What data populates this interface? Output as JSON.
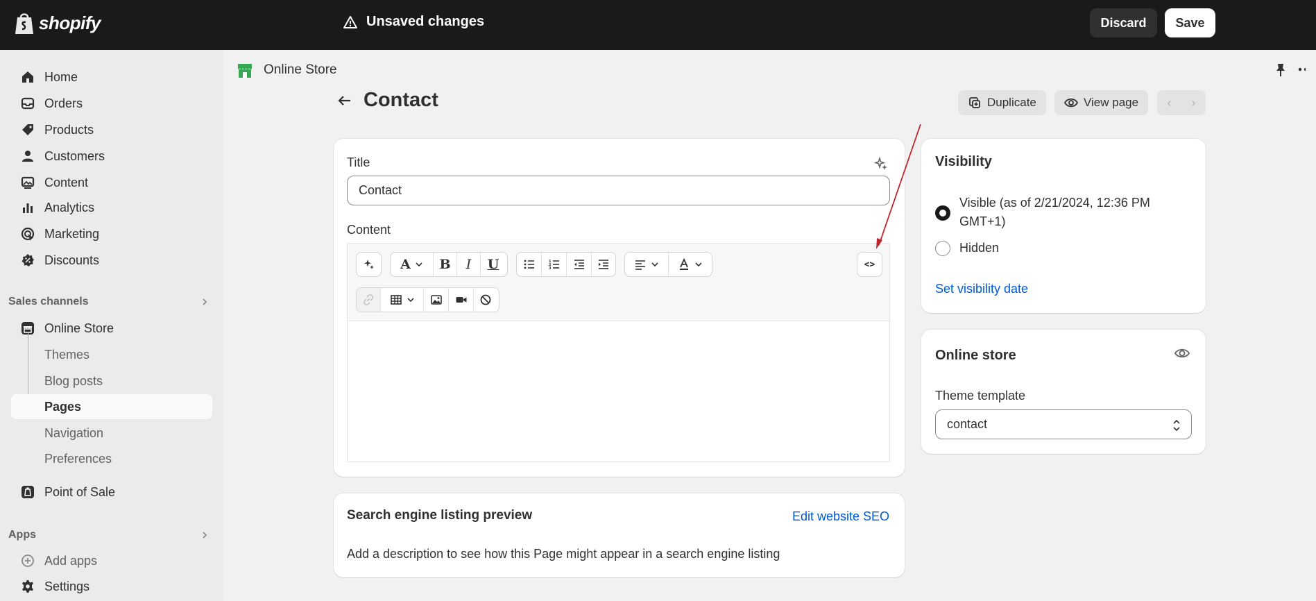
{
  "topbar": {
    "logo_text": "shopify",
    "status": "Unsaved changes",
    "discard_label": "Discard",
    "save_label": "Save"
  },
  "sidebar": {
    "items": [
      {
        "label": "Home",
        "icon": "home-icon"
      },
      {
        "label": "Orders",
        "icon": "inbox-icon"
      },
      {
        "label": "Products",
        "icon": "tag-icon"
      },
      {
        "label": "Customers",
        "icon": "person-icon"
      },
      {
        "label": "Content",
        "icon": "image-content-icon"
      },
      {
        "label": "Analytics",
        "icon": "bar-chart-icon"
      },
      {
        "label": "Marketing",
        "icon": "target-icon"
      },
      {
        "label": "Discounts",
        "icon": "discount-icon"
      }
    ],
    "sales_channels_label": "Sales channels",
    "online_store_label": "Online Store",
    "online_store_sub": [
      "Themes",
      "Blog posts",
      "Pages",
      "Navigation",
      "Preferences"
    ],
    "active_sub": "Pages",
    "point_of_sale_label": "Point of Sale",
    "apps_label": "Apps",
    "add_apps_label": "Add apps",
    "settings_label": "Settings"
  },
  "breadcrumb": {
    "label": "Online Store"
  },
  "page": {
    "title": "Contact",
    "duplicate_label": "Duplicate",
    "view_page_label": "View page"
  },
  "form": {
    "title_label": "Title",
    "title_value": "Contact",
    "content_label": "Content",
    "code_button_label": "<>"
  },
  "seo": {
    "title": "Search engine listing preview",
    "edit_label": "Edit website SEO",
    "description": "Add a description to see how this Page might appear in a search engine listing"
  },
  "visibility": {
    "title": "Visibility",
    "visible_label": "Visible (as of 2/21/2024, 12:36 PM",
    "visible_label_line2": "GMT+1)",
    "hidden_label": "Hidden",
    "set_date_label": "Set visibility date",
    "selected": "visible"
  },
  "online_store_card": {
    "title": "Online store",
    "template_label": "Theme template",
    "template_value": "contact"
  },
  "colors": {
    "topbar": "#1a1a1a",
    "link": "#005bd3",
    "annotation_arrow": "#c0262d"
  }
}
